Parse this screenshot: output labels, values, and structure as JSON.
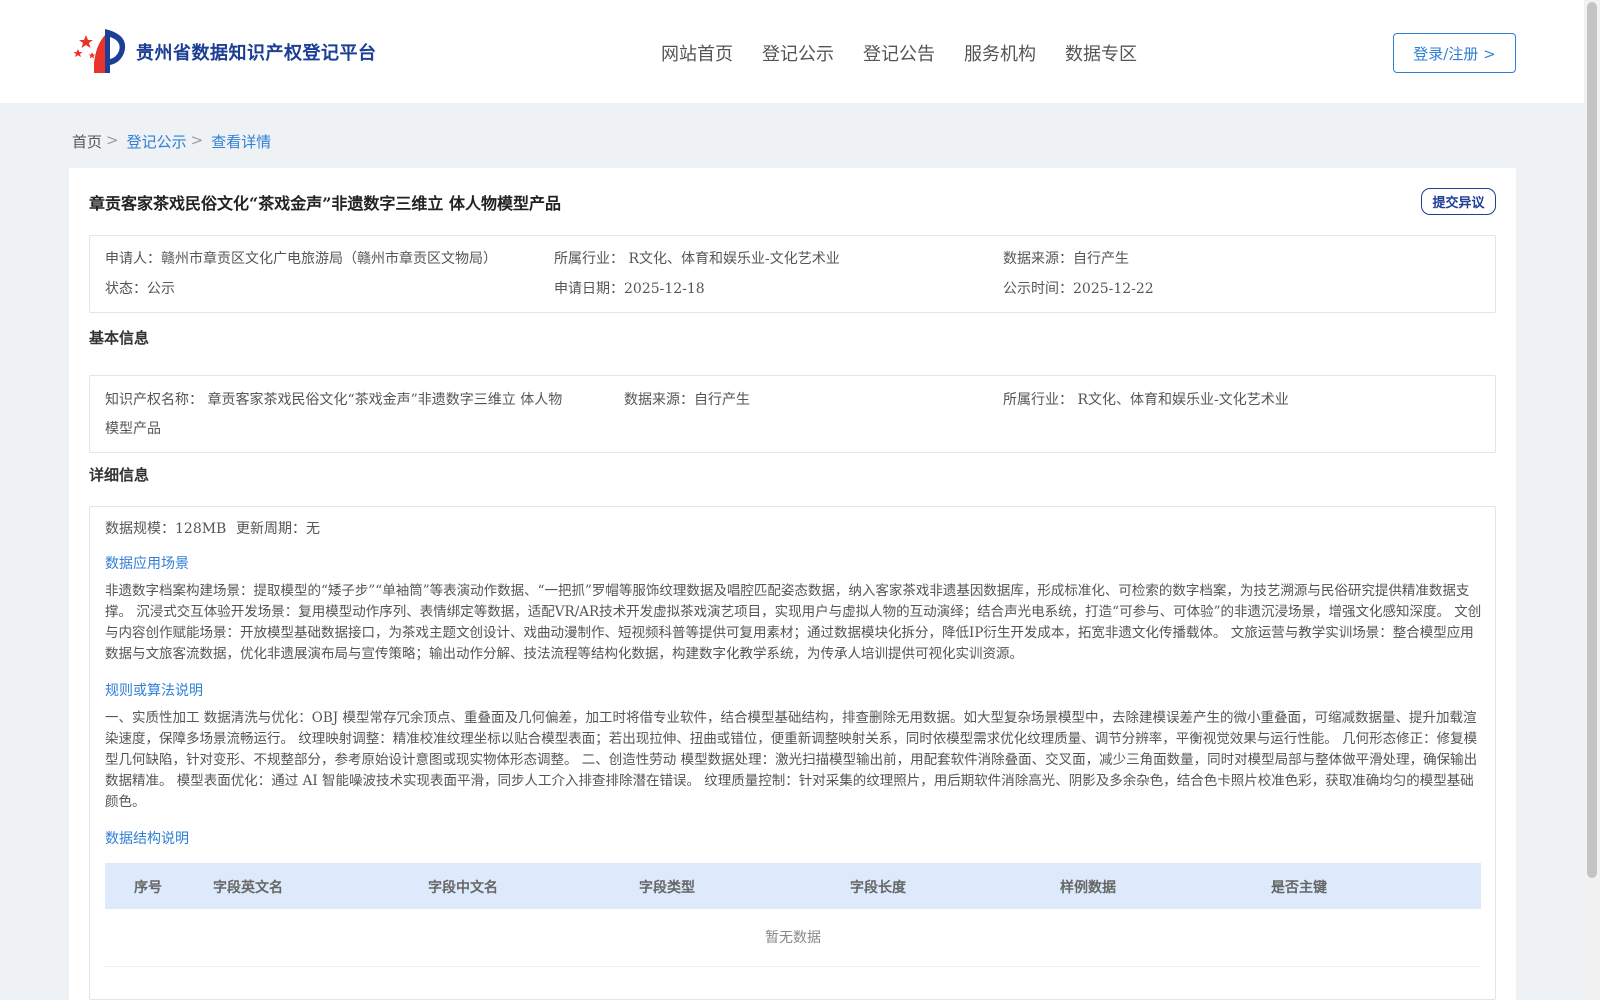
{
  "header": {
    "logo_text": "贵州省数据知识产权登记平台",
    "nav": [
      "网站首页",
      "登记公示",
      "登记公告",
      "服务机构",
      "数据专区"
    ],
    "login_label": "登录/注册 >"
  },
  "breadcrumb": {
    "home": "首页",
    "sep": ">",
    "items": [
      "登记公示",
      "查看详情"
    ]
  },
  "detail": {
    "title": "章贡客家茶戏民俗文化“茶戏金声”非遗数字三维立 体人物模型产品",
    "objection_label": "提交异议",
    "summary": {
      "applicant_label": "申请人：",
      "applicant": "赣州市章贡区文化广电旅游局（赣州市章贡区文物局）",
      "industry_label": "所属行业：",
      "industry": "R文化、体育和娱乐业-文化艺术业",
      "source_label": "数据来源：",
      "source": "自行产生",
      "status_label": "状态：",
      "status": "公示",
      "apply_date_label": "申请日期：",
      "apply_date": "2025-12-18",
      "publish_time_label": "公示时间：",
      "publish_time": "2025-12-22"
    },
    "basic": {
      "section_title": "基本信息",
      "ip_name_label": "知识产权名称：",
      "ip_name_line1": "章贡客家茶戏民俗文化“茶戏金声”非遗数字三维立 体人物",
      "ip_name_line2": "模型产品",
      "source_label": "数据来源：",
      "source": "自行产生",
      "industry_label": "所属行业：",
      "industry": "R文化、体育和娱乐业-文化艺术业"
    },
    "info": {
      "section_title": "详细信息",
      "scale_label": "数据规模：",
      "scale": "128MB",
      "cycle_label": "更新周期：",
      "cycle": "无",
      "scenario_title": "数据应用场景",
      "scenario_text": "非遗数字档案构建场景：提取模型的“矮子步”“单袖筒”等表演动作数据、“一把抓”罗帽等服饰纹理数据及唱腔匹配姿态数据，纳入客家茶戏非遗基因数据库，形成标准化、可检索的数字档案，为技艺溯源与民俗研究提供精准数据支撑。 沉浸式交互体验开发场景：复用模型动作序列、表情绑定等数据，适配VR/AR技术开发虚拟茶戏演艺项目，实现用户与虚拟人物的互动演绎；结合声光电系统，打造“可参与、可体验”的非遗沉浸场景，增强文化感知深度。 文创与内容创作赋能场景：开放模型基础数据接口，为茶戏主题文创设计、戏曲动漫制作、短视频科普等提供可复用素材；通过数据模块化拆分，降低IP衍生开发成本，拓宽非遗文化传播载体。 文旅运营与教学实训场景：整合模型应用数据与文旅客流数据，优化非遗展演布局与宣传策略；输出动作分解、技法流程等结构化数据，构建数字化教学系统，为传承人培训提供可视化实训资源。",
      "rules_title": "规则或算法说明",
      "rules_text": "一、实质性加工 数据清洗与优化：OBJ 模型常存冗余顶点、重叠面及几何偏差，加工时将借专业软件，结合模型基础结构，排查删除无用数据。如大型复杂场景模型中，去除建模误差产生的微小重叠面，可缩减数据量、提升加载渲染速度，保障多场景流畅运行。 纹理映射调整：精准校准纹理坐标以贴合模型表面；若出现拉伸、扭曲或错位，便重新调整映射关系，同时依模型需求优化纹理质量、调节分辨率，平衡视觉效果与运行性能。 几何形态修正：修复模型几何缺陷，针对变形、不规整部分，参考原始设计意图或现实物体形态调整。 二、创造性劳动 模型数据处理：激光扫描模型输出前，用配套软件消除叠面、交叉面，减少三角面数量，同时对模型局部与整体做平滑处理，确保输出数据精准。 模型表面优化：通过 AI 智能噪波技术实现表面平滑，同步人工介入排查排除潜在错误。 纹理质量控制：针对采集的纹理照片，用后期软件消除高光、阴影及多余杂色，结合色卡照片校准色彩，获取准确均匀的模型基础颜色。",
      "structure_title": "数据结构说明",
      "table_headers": [
        "序号",
        "字段英文名",
        "字段中文名",
        "字段类型",
        "字段长度",
        "样例数据",
        "是否主键"
      ],
      "empty_text": "暂无数据"
    }
  },
  "colors": {
    "accent": "#2f7fd6",
    "brand": "#1c3f95",
    "page_bg": "#eff2f5",
    "table_head_bg": "#ddeafb"
  }
}
